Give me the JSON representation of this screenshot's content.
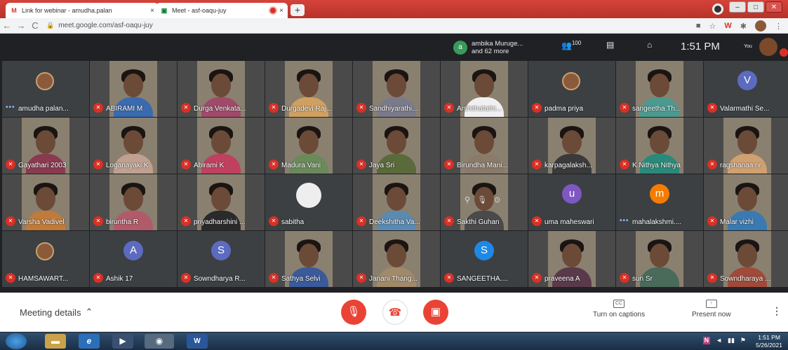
{
  "browser": {
    "tabs": [
      {
        "favicon": "M",
        "title": "Link for webinar - amudha.palan",
        "close": "×"
      },
      {
        "favicon": "▣",
        "title": "Meet - asf-oaqu-juy",
        "close": "×"
      }
    ],
    "new_tab": "+",
    "url": "meet.google.com/asf-oaqu-juy",
    "nav": {
      "back": "←",
      "forward": "→",
      "reload": "C"
    }
  },
  "meet": {
    "activity": {
      "avatar_letter": "a",
      "line1": "ambika Muruge...",
      "line2": "and 62 more"
    },
    "participants_count": "100",
    "clock": "1:51 PM",
    "you_label": "You",
    "tiles": [
      {
        "name": "amudha palan...",
        "kind": "photo",
        "speaking": true
      },
      {
        "name": "ABIRAMI M",
        "kind": "video",
        "shirt": "#3a6ab0"
      },
      {
        "name": "Durga Venkata...",
        "kind": "video",
        "shirt": "#a04a6a"
      },
      {
        "name": "Durgadevi Raj...",
        "kind": "video",
        "shirt": "#d0a060"
      },
      {
        "name": "Sandhiyarathi...",
        "kind": "video",
        "shirt": "#7a7a8a"
      },
      {
        "name": "Arshithafathi...",
        "kind": "video",
        "shirt": "#f0f0f0"
      },
      {
        "name": "padma priya",
        "kind": "photo"
      },
      {
        "name": "sangeetha Th...",
        "kind": "video",
        "shirt": "#4a9a90"
      },
      {
        "name": "Valarmathi Se...",
        "kind": "letter",
        "letter": "V",
        "color": "#5c6bc0"
      },
      {
        "name": "Gayathari 2003",
        "kind": "video",
        "shirt": "#8a3a50"
      },
      {
        "name": "Loganayaki K",
        "kind": "video",
        "shirt": "#c0a090"
      },
      {
        "name": "Abirami K",
        "kind": "video",
        "shirt": "#c04060"
      },
      {
        "name": "Madura Vani",
        "kind": "video",
        "shirt": "#6a8a5a"
      },
      {
        "name": "Jaya Sri",
        "kind": "video",
        "shirt": "#5a6a3a"
      },
      {
        "name": "Birundha Mani...",
        "kind": "video",
        "shirt": "#8a7a6a"
      },
      {
        "name": "karpagalaksh...",
        "kind": "video",
        "shirt": "#3a3a3a"
      },
      {
        "name": "K.Nithya Nithya",
        "kind": "video",
        "shirt": "#2a8a7a"
      },
      {
        "name": "ragshanaa nr",
        "kind": "video",
        "shirt": "#d0a070"
      },
      {
        "name": "Varsha Vadivel",
        "kind": "video",
        "shirt": "#c07a3a"
      },
      {
        "name": "biruntha R",
        "kind": "video",
        "shirt": "#b05a6a"
      },
      {
        "name": "priyadharshini ...",
        "kind": "video",
        "shirt": "#2a2a2a"
      },
      {
        "name": "sabitha",
        "kind": "blank"
      },
      {
        "name": "Deekshitha Va...",
        "kind": "video",
        "shirt": "#5a8ab0"
      },
      {
        "name": "Sakthi Guhan",
        "kind": "video",
        "shirt": "#4a4a4a",
        "hover": true
      },
      {
        "name": "uma maheswari",
        "kind": "letter",
        "letter": "u",
        "color": "#7e57c2"
      },
      {
        "name": "mahalakshmi....",
        "kind": "letter",
        "letter": "m",
        "color": "#f57c00",
        "speaking": true
      },
      {
        "name": "Malar vizhi",
        "kind": "video",
        "shirt": "#3a7ab0"
      },
      {
        "name": "HAMSAWART...",
        "kind": "photo"
      },
      {
        "name": "Ashik 17",
        "kind": "letter",
        "letter": "A",
        "color": "#5c6bc0"
      },
      {
        "name": "Sowndharya R...",
        "kind": "letter",
        "letter": "S",
        "color": "#5c6bc0"
      },
      {
        "name": "Sathya Selvi",
        "kind": "video",
        "shirt": "#3a5a9a"
      },
      {
        "name": "Janani Thang...",
        "kind": "video",
        "shirt": "#a08a6a"
      },
      {
        "name": "SANGEETHA....",
        "kind": "letter",
        "letter": "S",
        "color": "#1e88e5"
      },
      {
        "name": "praveena A",
        "kind": "video",
        "shirt": "#5a3a4a"
      },
      {
        "name": "sun Sr",
        "kind": "video",
        "shirt": "#4a6a5a"
      },
      {
        "name": "Sowndharaya ...",
        "kind": "video",
        "shirt": "#a04a3a"
      }
    ]
  },
  "bottom": {
    "meeting_details": "Meeting details",
    "captions_label": "Turn on captions",
    "present_label": "Present now"
  },
  "taskbar": {
    "time": "1:51 PM",
    "date": "5/26/2021",
    "word_label": "W"
  },
  "colors": {
    "meet_bg": "#202124",
    "muted_red": "#d93025",
    "tile_bg": "#3c4043"
  }
}
